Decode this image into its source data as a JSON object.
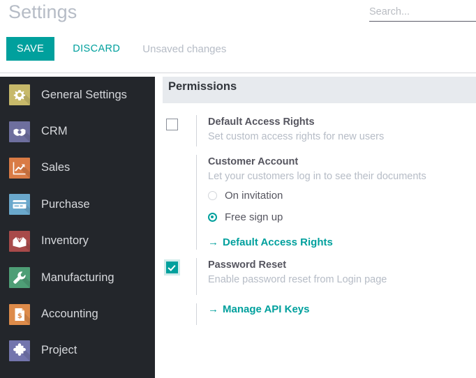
{
  "header": {
    "title": "Settings",
    "search": {
      "placeholder": "Search...",
      "value": ""
    }
  },
  "actionbar": {
    "save_label": "SAVE",
    "discard_label": "DISCARD",
    "status_label": "Unsaved changes"
  },
  "sidebar": {
    "items": [
      {
        "label": "General Settings",
        "icon": "gear-icon",
        "bg": "#c7b96a",
        "active": true
      },
      {
        "label": "CRM",
        "icon": "handshake-icon",
        "bg": "#6e6f9e",
        "active": false
      },
      {
        "label": "Sales",
        "icon": "chart-arrow-icon",
        "bg": "#d97b45",
        "active": false
      },
      {
        "label": "Purchase",
        "icon": "credit-card-icon",
        "bg": "#6aa8cc",
        "active": false
      },
      {
        "label": "Inventory",
        "icon": "box-icon",
        "bg": "#a84a4a",
        "active": false
      },
      {
        "label": "Manufacturing",
        "icon": "wrench-icon",
        "bg": "#4e9e76",
        "active": false
      },
      {
        "label": "Accounting",
        "icon": "invoice-dollar-icon",
        "bg": "#dd8b4a",
        "active": false
      },
      {
        "label": "Project",
        "icon": "puzzle-icon",
        "bg": "#7375ad",
        "active": false
      }
    ]
  },
  "main": {
    "section_title": "Permissions",
    "settings": [
      {
        "name": "default-access-rights",
        "control": "checkbox",
        "checked": false,
        "title": "Default Access Rights",
        "description": "Set custom access rights for new users"
      },
      {
        "name": "customer-account",
        "control": "none",
        "title": "Customer Account",
        "description": "Let your customers log in to see their documents",
        "radios": [
          {
            "label": "On invitation",
            "selected": false
          },
          {
            "label": "Free sign up",
            "selected": true
          }
        ],
        "link": {
          "arrow": "→",
          "label": "Default Access Rights"
        }
      },
      {
        "name": "password-reset",
        "control": "checkbox",
        "checked": true,
        "title": "Password Reset",
        "description": "Enable password reset from Login page",
        "link": {
          "arrow": "→",
          "label": "Manage API Keys"
        }
      }
    ]
  },
  "colors": {
    "accent": "#00a09d",
    "sidebar_bg": "#23262b",
    "band_bg": "#e7eaee",
    "muted_text": "#b6bcc6",
    "title_text": "#55555f"
  }
}
